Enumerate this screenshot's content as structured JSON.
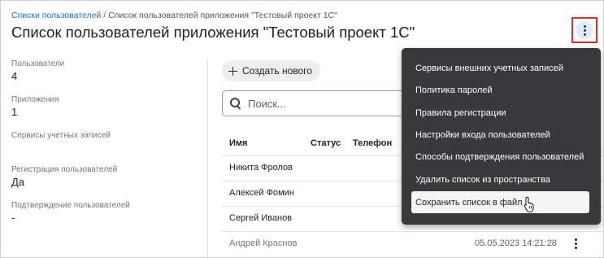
{
  "breadcrumb": {
    "link": "Списки пользователей",
    "separator": "/",
    "current": "Список пользователей приложения \"Тестовый проект 1С\""
  },
  "page_title": "Список пользователей приложения \"Тестовый проект 1С\"",
  "sidebar": {
    "fields": [
      {
        "label": "Пользователи",
        "value": "4"
      },
      {
        "label": "Приложения",
        "value": "1"
      },
      {
        "label": "Сервисы учетных записей",
        "value": ""
      },
      {
        "label": "Регистрация пользователей",
        "value": "Да"
      },
      {
        "label": "Подтверждение пользователей",
        "value": "-"
      }
    ]
  },
  "toolbar": {
    "create_label": "Создать нового",
    "search_placeholder": "Поиск..."
  },
  "table": {
    "columns": [
      "Имя",
      "Статус",
      "Телефон"
    ],
    "rows": [
      {
        "name": "Никита Фролов",
        "date": ""
      },
      {
        "name": "Алексей Фомин",
        "date": ""
      },
      {
        "name": "Сергей Иванов",
        "date": ""
      },
      {
        "name": "Андрей Краснов",
        "date": "05.05.2023 14:21:28"
      }
    ]
  },
  "menu": {
    "items": [
      "Сервисы внешних учетных записей",
      "Политика паролей",
      "Правила регистрации",
      "Настройки входа пользователей",
      "Способы подтверждения пользователей",
      "Удалить список из пространства",
      "Сохранить список в файл"
    ],
    "hovered_index": 6
  },
  "icons": {
    "more": "more-vertical-icon",
    "plus": "plus-icon",
    "search": "search-icon",
    "cursor": "hand-pointer-icon"
  },
  "colors": {
    "link": "#1a73e8",
    "menu_bg": "#37393b",
    "highlight_border": "#d32f2f",
    "more_button_bg": "#e3edf9"
  }
}
